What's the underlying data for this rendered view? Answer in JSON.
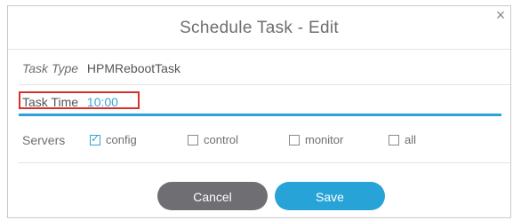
{
  "dialog": {
    "title": "Schedule Task - Edit",
    "close_symbol": "×"
  },
  "task_type": {
    "label": "Task Type",
    "value": "HPMRebootTask"
  },
  "task_time": {
    "label": "Task Time",
    "value": "10:00"
  },
  "servers": {
    "label": "Servers",
    "options": [
      {
        "label": "config",
        "checked": true
      },
      {
        "label": "control",
        "checked": false
      },
      {
        "label": "monitor",
        "checked": false
      },
      {
        "label": "all",
        "checked": false
      }
    ]
  },
  "buttons": {
    "cancel_label": "Cancel",
    "save_label": "Save"
  },
  "colors": {
    "accent": "#27a3d7",
    "highlight_border": "#d9302b",
    "cancel_button": "#6f6f73"
  },
  "icons": {
    "close": "close-icon",
    "check": "check-icon"
  }
}
